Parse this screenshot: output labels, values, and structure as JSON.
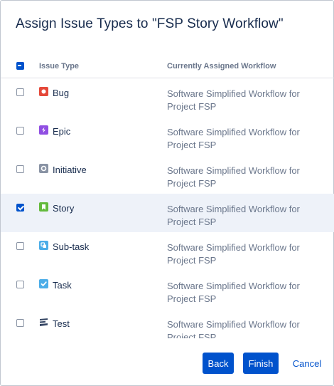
{
  "dialog": {
    "title": "Assign Issue Types to \"FSP Story Workflow\""
  },
  "table": {
    "header_select_state": "indeterminate",
    "columns": [
      "Issue Type",
      "Currently Assigned Workflow"
    ],
    "rows": [
      {
        "name": "Bug",
        "icon": "bug-icon",
        "icon_color": "#e5493a",
        "workflow": "Software Simplified Workflow for Project FSP",
        "checked": false
      },
      {
        "name": "Epic",
        "icon": "epic-icon",
        "icon_color": "#904ee2",
        "workflow": "Software Simplified Workflow for Project FSP",
        "checked": false
      },
      {
        "name": "Initiative",
        "icon": "initiative-icon",
        "icon_color": "#8993a4",
        "workflow": "Software Simplified Workflow for Project FSP",
        "checked": false
      },
      {
        "name": "Story",
        "icon": "story-icon",
        "icon_color": "#63ba3c",
        "workflow": "Software Simplified Workflow for Project FSP",
        "checked": true
      },
      {
        "name": "Sub-task",
        "icon": "subtask-icon",
        "icon_color": "#4bade8",
        "workflow": "Software Simplified Workflow for Project FSP",
        "checked": false
      },
      {
        "name": "Task",
        "icon": "task-icon",
        "icon_color": "#4bade8",
        "workflow": "Software Simplified Workflow for Project FSP",
        "checked": false
      },
      {
        "name": "Test",
        "icon": "test-icon",
        "icon_color": "#344563",
        "workflow": "Software Simplified Workflow for Project FSP",
        "checked": false
      }
    ]
  },
  "footer": {
    "back_label": "Back",
    "finish_label": "Finish",
    "cancel_label": "Cancel"
  },
  "colors": {
    "primary": "#0052cc",
    "selected_row": "#eef2f9",
    "muted_text": "#6b778c"
  }
}
